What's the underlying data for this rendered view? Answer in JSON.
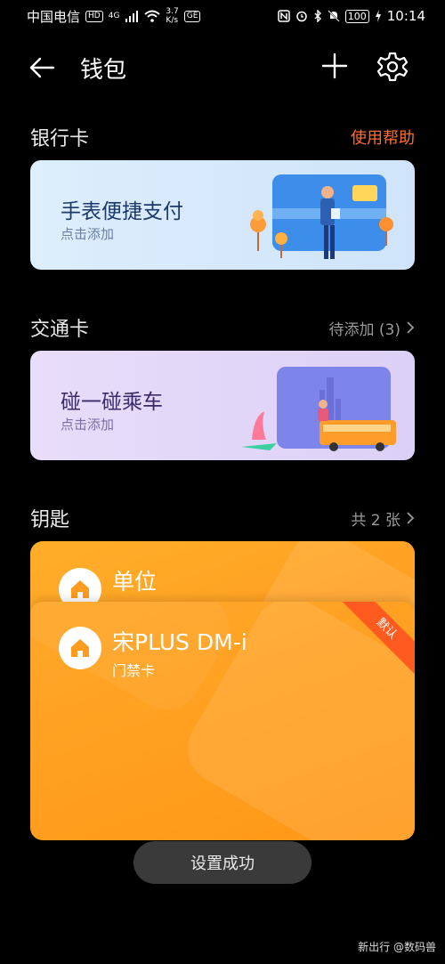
{
  "status_bar": {
    "carrier": "中国电信",
    "hd": "HD",
    "network": "4G",
    "speed_value": "3.7",
    "speed_unit": "K/s",
    "extra_badge": "GE",
    "battery": "100",
    "time": "10:14"
  },
  "header": {
    "title": "钱包"
  },
  "bank": {
    "title": "银行卡",
    "help_link": "使用帮助",
    "card_title": "手表便捷支付",
    "card_sub": "点击添加"
  },
  "transit": {
    "title": "交通卡",
    "pending_link": "待添加 (3)",
    "card_title": "碰一碰乘车",
    "card_sub": "点击添加"
  },
  "keys": {
    "title": "钥匙",
    "count_link": "共 2 张",
    "items": [
      {
        "name": "单位",
        "type": ""
      },
      {
        "name": "宋PLUS DM-i",
        "type": "门禁卡",
        "badge": "默认"
      }
    ]
  },
  "toast": "设置成功",
  "watermark": "新出行 @数码兽",
  "colors": {
    "accent_orange": "#ff6e33",
    "key_card": "#ff9b1f",
    "ribbon": "#ff5a1f"
  }
}
